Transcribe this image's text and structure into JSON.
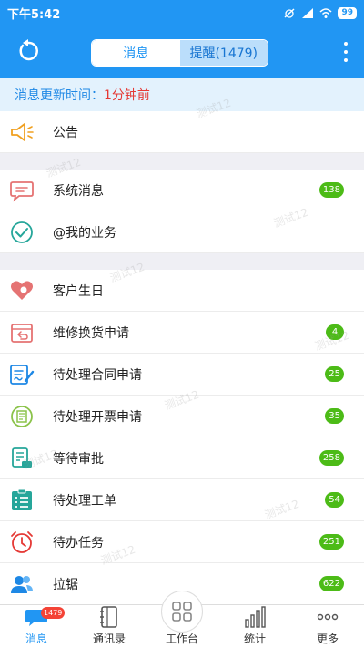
{
  "status_bar": {
    "time": "下午5:42",
    "battery": "99"
  },
  "header": {
    "tabs": [
      {
        "label": "消息",
        "active": false
      },
      {
        "label": "提醒(1479)",
        "active": true
      }
    ]
  },
  "update_bar": {
    "label": "消息更新时间：",
    "value": "1分钟前"
  },
  "sections": [
    {
      "items": [
        {
          "label": "公告",
          "icon": "megaphone-icon",
          "badge": ""
        }
      ]
    },
    {
      "items": [
        {
          "label": "系统消息",
          "icon": "chat-bubble-icon",
          "badge": "138"
        },
        {
          "label": "@我的业务",
          "icon": "check-circle-icon",
          "badge": ""
        }
      ]
    },
    {
      "items": [
        {
          "label": "客户生日",
          "icon": "heart-icon",
          "badge": ""
        },
        {
          "label": "维修换货申请",
          "icon": "return-box-icon",
          "badge": "4"
        },
        {
          "label": "待处理合同申请",
          "icon": "contract-edit-icon",
          "badge": "25"
        },
        {
          "label": "待处理开票申请",
          "icon": "invoice-icon",
          "badge": "35"
        },
        {
          "label": "等待审批",
          "icon": "approval-doc-icon",
          "badge": "258"
        },
        {
          "label": "待处理工单",
          "icon": "clipboard-list-icon",
          "badge": "54"
        },
        {
          "label": "待办任务",
          "icon": "alarm-clock-icon",
          "badge": "251"
        },
        {
          "label": "拉锯",
          "icon": "users-icon",
          "badge": "622"
        }
      ]
    }
  ],
  "watermark": "测试12",
  "bottom_nav": [
    {
      "label": "消息",
      "icon": "message-icon",
      "badge": "1479",
      "active": true
    },
    {
      "label": "通讯录",
      "icon": "contacts-book-icon",
      "badge": "",
      "active": false
    },
    {
      "label": "工作台",
      "icon": "workbench-grid-icon",
      "badge": "",
      "active": false
    },
    {
      "label": "统计",
      "icon": "bar-stats-icon",
      "badge": "",
      "active": false
    },
    {
      "label": "更多",
      "icon": "more-dots-icon",
      "badge": "",
      "active": false
    }
  ],
  "colors": {
    "primary": "#2196f3",
    "badge_green": "#4cbb17",
    "alert_red": "#e53935"
  }
}
